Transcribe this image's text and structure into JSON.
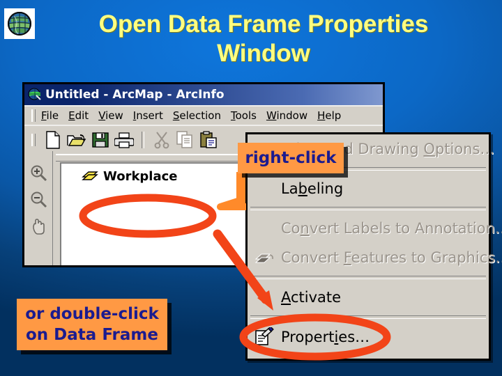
{
  "slide": {
    "title_line1": "Open Data Frame Properties",
    "title_line2": "Window",
    "title_color": "#ffff80",
    "background_color": "#0a5fb4",
    "logo_icon": "globe-icon"
  },
  "arcmap": {
    "window_title": "Untitled - ArcMap - ArcInfo",
    "title_icon": "arcmap-globe-icon",
    "menus": [
      {
        "pre": "",
        "accel": "F",
        "post": "ile"
      },
      {
        "pre": "",
        "accel": "E",
        "post": "dit"
      },
      {
        "pre": "",
        "accel": "V",
        "post": "iew"
      },
      {
        "pre": "",
        "accel": "I",
        "post": "nsert"
      },
      {
        "pre": "",
        "accel": "S",
        "post": "election"
      },
      {
        "pre": "",
        "accel": "T",
        "post": "ools"
      },
      {
        "pre": "",
        "accel": "W",
        "post": "indow"
      },
      {
        "pre": "",
        "accel": "H",
        "post": "elp"
      }
    ],
    "toolbar_icons": [
      "new-document-icon",
      "open-folder-icon",
      "save-floppy-icon",
      "print-icon",
      "cut-scissors-icon",
      "copy-icon",
      "paste-icon"
    ],
    "left_toolbar_icons": [
      "zoom-in-icon",
      "zoom-out-icon",
      "pan-hand-icon"
    ],
    "toc": {
      "layer_label": "Workplace",
      "layer_icon": "layers-icon"
    }
  },
  "context_menu": {
    "items": [
      {
        "type": "item",
        "pre": "Advanced Drawing ",
        "accel": "O",
        "post": "ptions…",
        "state": "disabled",
        "icon": ""
      },
      {
        "type": "separator"
      },
      {
        "type": "item",
        "pre": "La",
        "accel": "b",
        "post": "eling",
        "state": "enabled",
        "icon": ""
      },
      {
        "type": "separator"
      },
      {
        "type": "item",
        "pre": "Co",
        "accel": "n",
        "post": "vert Labels to Annotation…",
        "state": "disabled",
        "icon": ""
      },
      {
        "type": "item",
        "pre": "Convert ",
        "accel": "F",
        "post": "eatures to Graphics…",
        "state": "disabled",
        "icon": "convert-features-icon"
      },
      {
        "type": "separator"
      },
      {
        "type": "item",
        "pre": "",
        "accel": "A",
        "post": "ctivate",
        "state": "enabled",
        "icon": ""
      },
      {
        "type": "separator"
      },
      {
        "type": "item",
        "pre": "Propert",
        "accel": "i",
        "post": "es…",
        "state": "enabled",
        "icon": "properties-icon"
      }
    ]
  },
  "callouts": {
    "right_click": "right-click",
    "double_click_line1": "or double-click",
    "double_click_line2": "on Data Frame",
    "fill_color": "#ff9944",
    "text_color": "#1b1b8f"
  },
  "annotations": {
    "highlight_color": "#f24418",
    "workplace_circle": "highlight-ellipse-workplace",
    "properties_circle": "highlight-ellipse-properties",
    "arrow_workplace_to_properties": "annotation-arrow"
  }
}
